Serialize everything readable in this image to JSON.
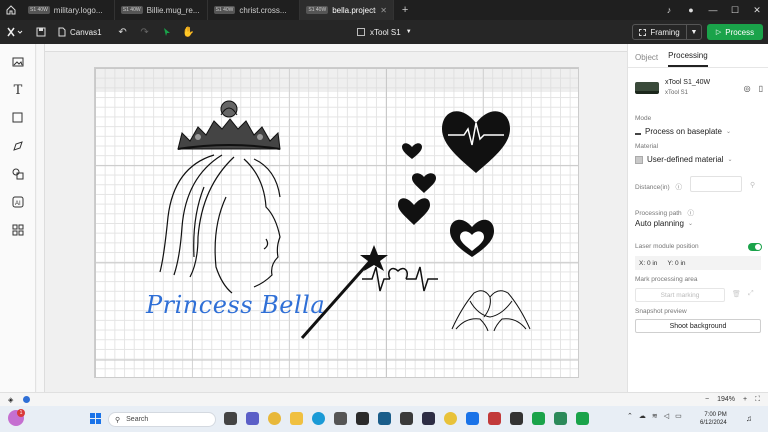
{
  "titlebar": {
    "tabs": [
      {
        "badge": "S1 40W",
        "name": "military.logo..."
      },
      {
        "badge": "S1 40W",
        "name": "Billie.mug_re..."
      },
      {
        "badge": "S1 40W",
        "name": "christ.cross..."
      },
      {
        "badge": "S1 40W",
        "name": "bella.projects",
        "active": true
      }
    ]
  },
  "toolbar": {
    "canvas_name": "Canvas1",
    "device": "xTool S1",
    "framing_label": "Framing",
    "process_label": "Process"
  },
  "design": {
    "text": "Princess Bella"
  },
  "right_panel": {
    "tabs": [
      "Object",
      "Processing"
    ],
    "device_name": "xTool S1_40W",
    "device_model": "xTool S1",
    "mode_label": "Mode",
    "mode_value": "Process on baseplate",
    "material_label": "Material",
    "material_value": "User-defined material",
    "distance_label": "Distance(in)",
    "path_label": "Processing path",
    "path_value": "Auto planning",
    "laser_label": "Laser module position",
    "x_value": "X: 0 in",
    "y_value": "Y: 0 in",
    "mark_label": "Mark processing area",
    "start_marking": "Start marking",
    "snapshot_label": "Snapshot preview",
    "shoot_label": "Shoot background"
  },
  "statusbar": {
    "zoom": "194%"
  },
  "taskbar": {
    "search_placeholder": "Search",
    "time": "7:00 PM",
    "date": "6/12/2024",
    "notification_count": "1"
  },
  "colors": {
    "accent": "#1aa34a",
    "text_blue": "#2f6fd6"
  }
}
